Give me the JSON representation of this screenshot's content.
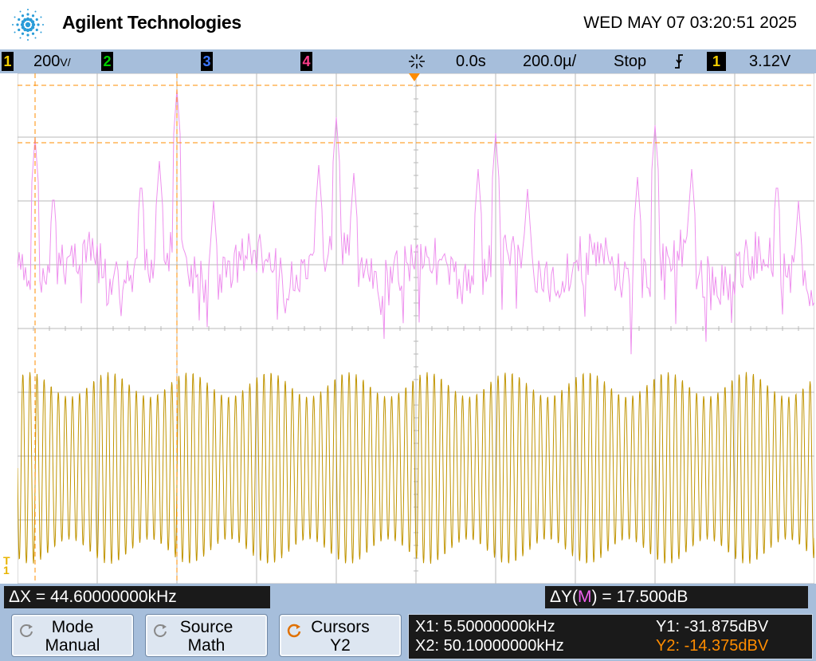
{
  "header": {
    "brand": "Agilent Technologies",
    "datetime": "WED MAY 07 03:20:51 2025",
    "logo_icon": "agilent-spark-icon"
  },
  "statusbar": {
    "ch1_number": "1",
    "ch1_scale": "200",
    "ch1_unit_glyph": "V/",
    "ch2_number": "2",
    "ch3_number": "3",
    "ch4_number": "4",
    "trigger_icon": "trigger-spark-icon",
    "time_delay": "0.0s",
    "time_scale": "200.0µ/",
    "run_state": "Stop",
    "edge_icon": "falling-edge-icon",
    "trig_source": "1",
    "trig_level": "3.12V",
    "colors": {
      "ch1": "#f5d000",
      "ch2": "#00d000",
      "ch3": "#3c78ff",
      "ch4": "#ff3c8c"
    }
  },
  "screen": {
    "colors": {
      "ch1_trace": "#c09400",
      "math_trace": "#ee90ee",
      "grid": "#b8b8b8",
      "cursor": "#ff8c00",
      "ch1_marker": "#e8b400"
    },
    "ch1_marker_label": "T\n1"
  },
  "measurements": {
    "delta_x": "ΔX = 44.60000000kHz",
    "delta_y_prefix": "ΔY(",
    "delta_y_source": "M",
    "delta_y_suffix": ") = 17.500dB"
  },
  "softkeys": [
    {
      "line1": "Mode",
      "line2": "Manual",
      "icon": "rotate-knob-icon"
    },
    {
      "line1": "Source",
      "line2": "Math",
      "icon": "rotate-knob-icon"
    },
    {
      "line1": "Cursors",
      "line2": "Y2",
      "icon": "rotate-knob-icon-active"
    }
  ],
  "cursor_readout": {
    "x1": "X1: 5.50000000kHz",
    "x2": "X2: 50.10000000kHz",
    "y1": "Y1: -31.875dBV",
    "y2": "Y2: -14.375dBV"
  }
}
